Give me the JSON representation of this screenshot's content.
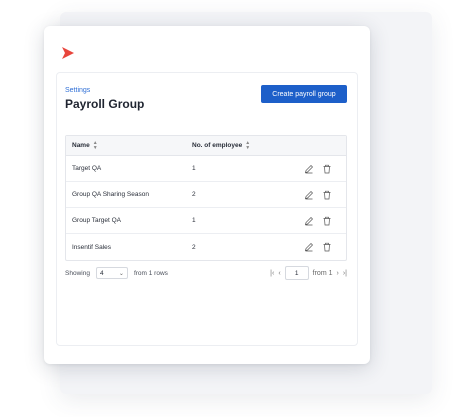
{
  "breadcrumb": "Settings",
  "page_title": "Payroll Group",
  "create_button": "Create payroll group",
  "table": {
    "headers": {
      "name": "Name",
      "count": "No. of employee"
    },
    "rows": [
      {
        "name": "Target QA",
        "count": "1"
      },
      {
        "name": "Group QA Sharing Season",
        "count": "2"
      },
      {
        "name": "Group Target QA",
        "count": "1"
      },
      {
        "name": "Insentif Sales",
        "count": "2"
      }
    ]
  },
  "footer": {
    "showing_label": "Showing",
    "page_size": "4",
    "rows_text": "from 1 rows",
    "page_number": "1",
    "page_of": "from 1"
  },
  "colors": {
    "accent": "#1d5fc9",
    "logo": "#e8453c"
  }
}
